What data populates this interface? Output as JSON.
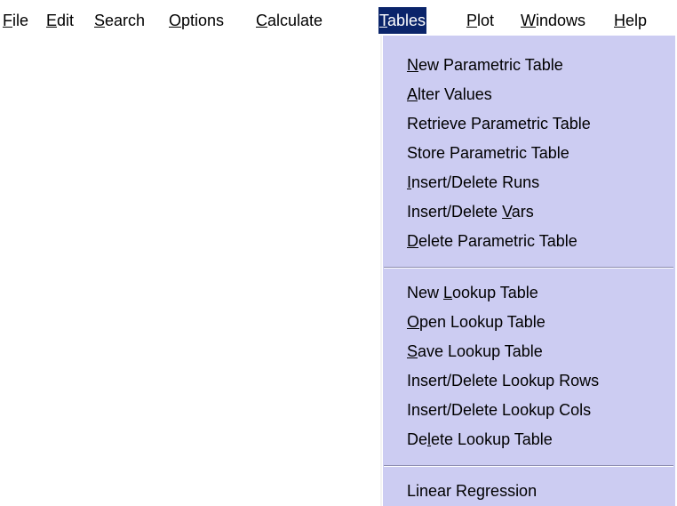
{
  "menubar": {
    "items": [
      {
        "pre": "",
        "acc": "F",
        "post": "ile"
      },
      {
        "pre": "",
        "acc": "E",
        "post": "dit"
      },
      {
        "pre": "",
        "acc": "S",
        "post": "earch"
      },
      {
        "pre": "",
        "acc": "O",
        "post": "ptions"
      },
      {
        "pre": "",
        "acc": "C",
        "post": "alculate"
      },
      {
        "pre": "",
        "acc": "T",
        "post": "ables"
      },
      {
        "pre": "",
        "acc": "P",
        "post": "lot"
      },
      {
        "pre": "",
        "acc": "W",
        "post": "indows"
      },
      {
        "pre": "",
        "acc": "H",
        "post": "elp"
      }
    ]
  },
  "tables_menu": {
    "items": [
      {
        "pre": "",
        "acc": "N",
        "post": "ew Parametric Table"
      },
      {
        "pre": "",
        "acc": "A",
        "post": "lter Values"
      },
      {
        "pre": "Retrieve Parametric Table",
        "acc": "",
        "post": ""
      },
      {
        "pre": "Store Parametric Table",
        "acc": "",
        "post": ""
      },
      {
        "pre": "",
        "acc": "I",
        "post": "nsert/Delete Runs"
      },
      {
        "pre": "Insert/Delete ",
        "acc": "V",
        "post": "ars"
      },
      {
        "pre": "",
        "acc": "D",
        "post": "elete Parametric Table"
      },
      {
        "pre": "New ",
        "acc": "L",
        "post": "ookup Table"
      },
      {
        "pre": "",
        "acc": "O",
        "post": "pen Lookup Table"
      },
      {
        "pre": "",
        "acc": "S",
        "post": "ave Lookup Table"
      },
      {
        "pre": "Insert/Delete Lookup Rows",
        "acc": "",
        "post": ""
      },
      {
        "pre": "Insert/Delete Lookup Cols",
        "acc": "",
        "post": ""
      },
      {
        "pre": "De",
        "acc": "l",
        "post": "ete Lookup Table"
      },
      {
        "pre": "Linear Regression",
        "acc": "",
        "post": ""
      }
    ]
  }
}
